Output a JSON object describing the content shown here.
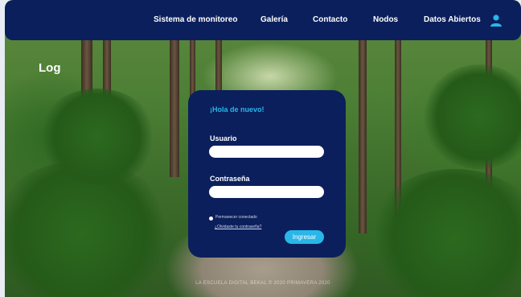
{
  "nav": {
    "items": [
      {
        "label": "Sistema de monitoreo"
      },
      {
        "label": "Galería"
      },
      {
        "label": "Contacto"
      },
      {
        "label": "Nodos"
      },
      {
        "label": "Datos Abiertos"
      }
    ],
    "user_icon": "user-icon"
  },
  "hero": {
    "log_text": "Log"
  },
  "login": {
    "title": "¡Hola de nuevo!",
    "username_label": "Usuario",
    "username_value": "",
    "password_label": "Contraseña",
    "password_value": "",
    "remember_label": "Permanecer conectado",
    "forgot_link": "¿Olvidaste tu contraseña?",
    "submit_label": "Ingresar"
  },
  "footer": {
    "text": "LA ESCUELA DIGITAL BEKAL © 2020 PRIMAVERA 2020"
  },
  "colors": {
    "navy": "#0b1f5c",
    "accent": "#29b6e8"
  }
}
